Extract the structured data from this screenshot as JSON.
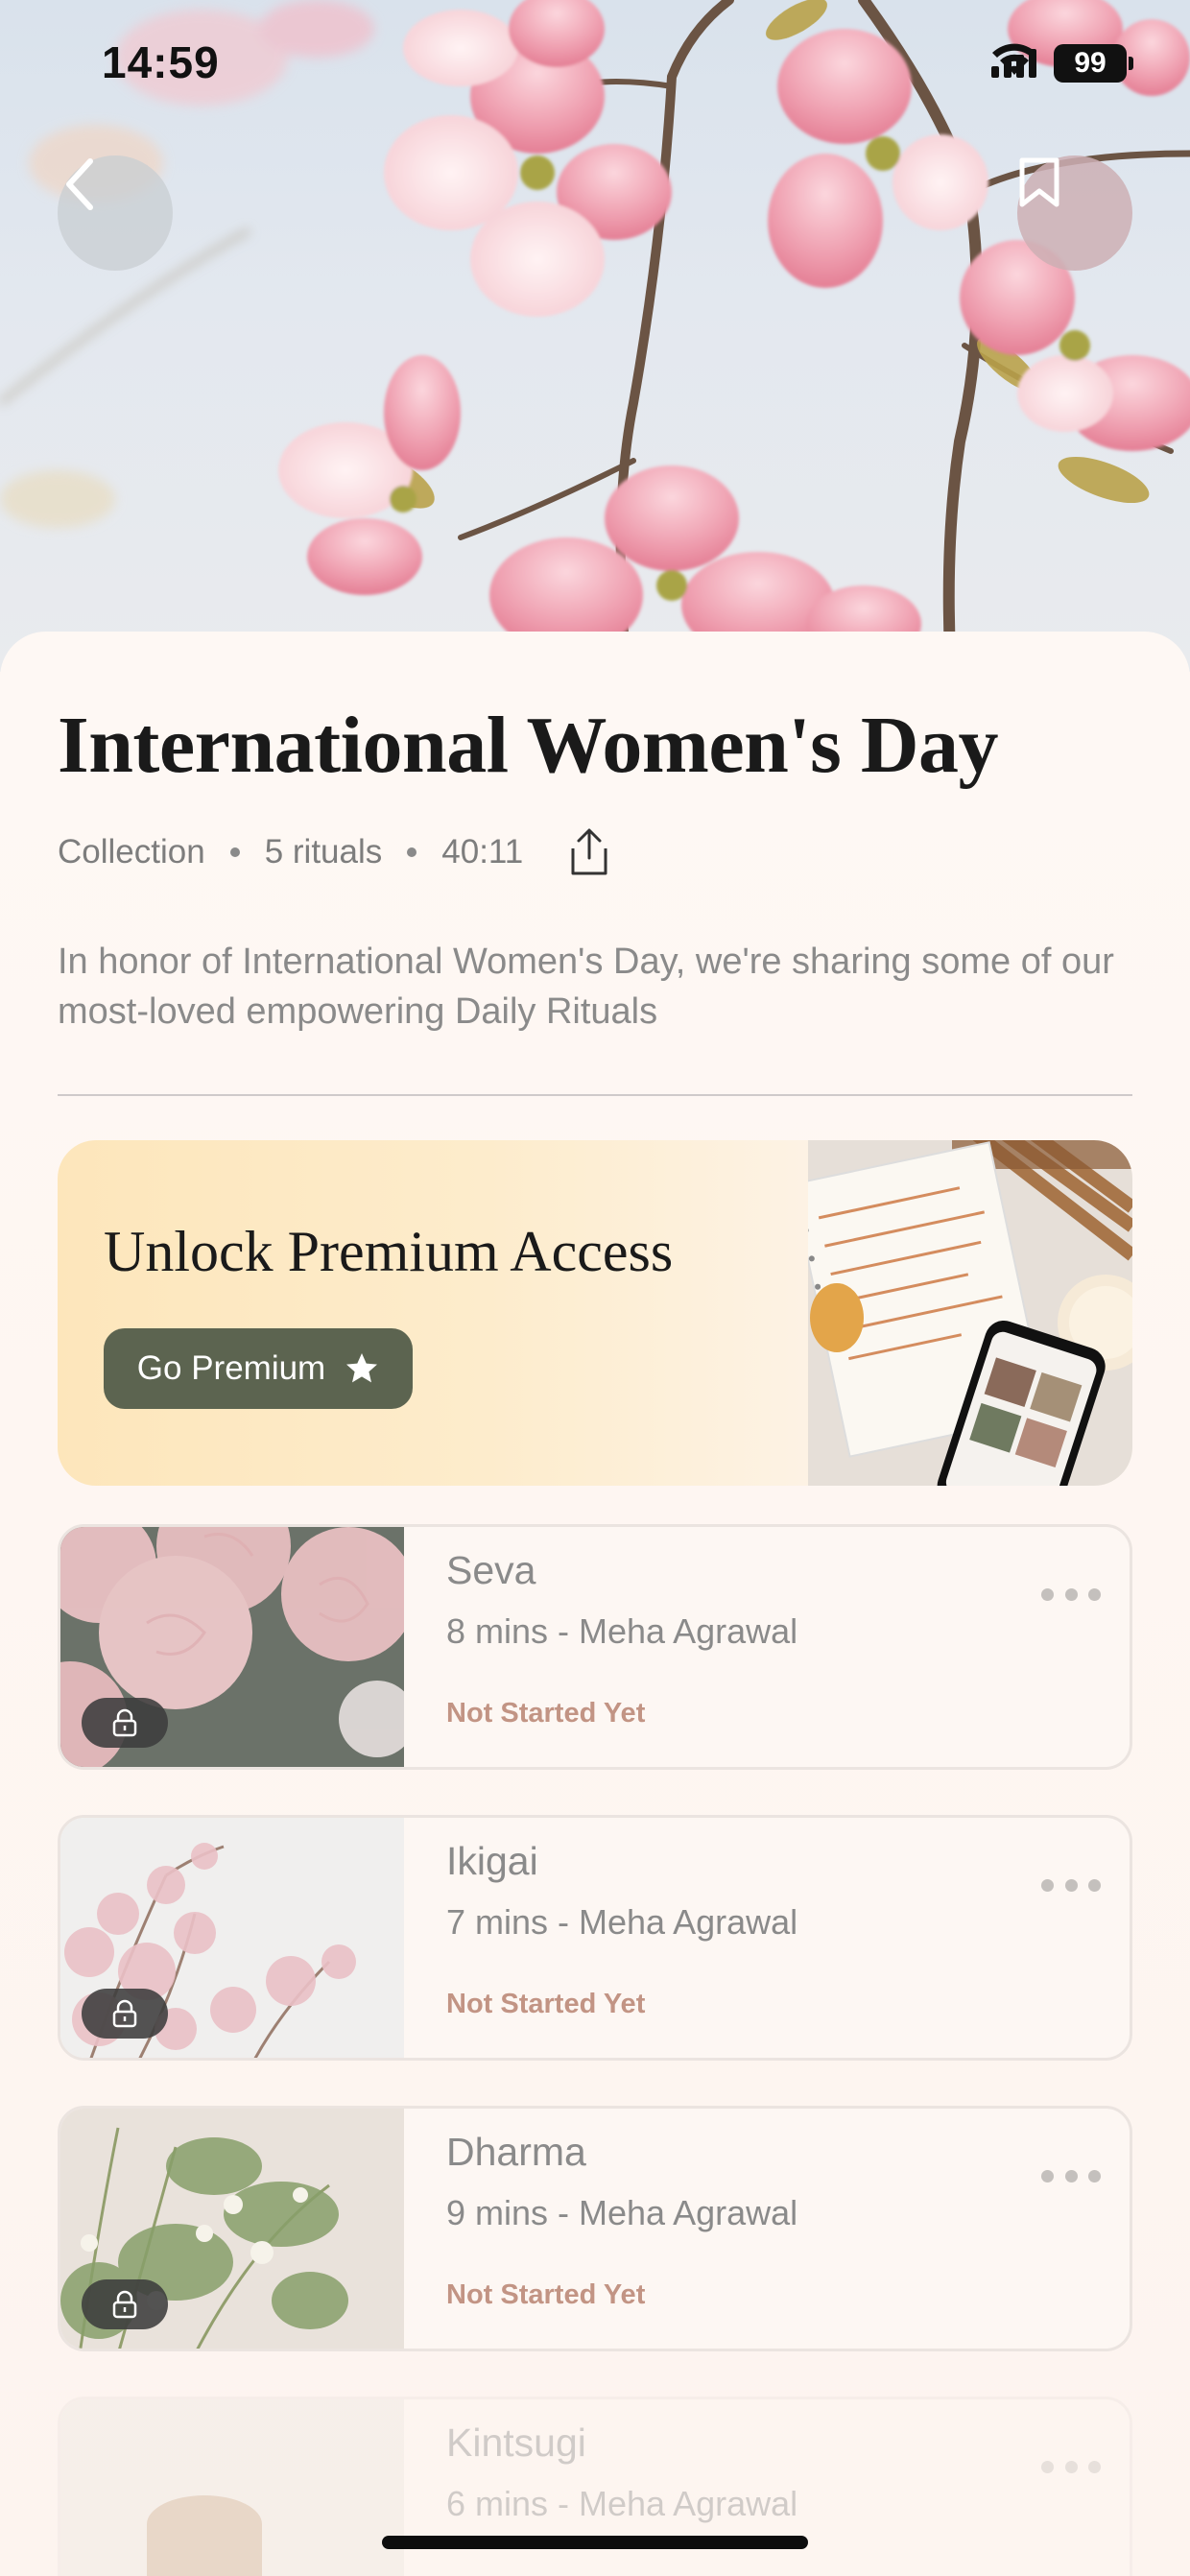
{
  "status_bar": {
    "time": "14:59",
    "battery": "99"
  },
  "header": {
    "back_icon": "chevron-left-icon",
    "bookmark_icon": "bookmark-icon"
  },
  "collection": {
    "title": "International Women's Day",
    "type": "Collection",
    "count": "5 rituals",
    "duration": "40:11",
    "share_icon": "share-icon",
    "description": "In honor of International Women's Day, we're sharing some of our most-loved empowering Daily Rituals"
  },
  "premium": {
    "title": "Unlock Premium Access",
    "button_label": "Go Premium",
    "button_icon": "star-icon",
    "button_color": "#5c6450"
  },
  "rituals": [
    {
      "name": "Seva",
      "subtitle": "8 mins - Meha Agrawal",
      "status": "Not Started Yet",
      "locked": true
    },
    {
      "name": "Ikigai",
      "subtitle": "7 mins - Meha Agrawal",
      "status": "Not Started Yet",
      "locked": true
    },
    {
      "name": "Dharma",
      "subtitle": "9 mins - Meha Agrawal",
      "status": "Not Started Yet",
      "locked": true
    },
    {
      "name": "Kintsugi",
      "subtitle": "6 mins - Meha Agrawal",
      "status": "",
      "locked": true
    }
  ],
  "colors": {
    "status_accent": "#c29484",
    "sheet_bg": "#fdf5f0"
  }
}
